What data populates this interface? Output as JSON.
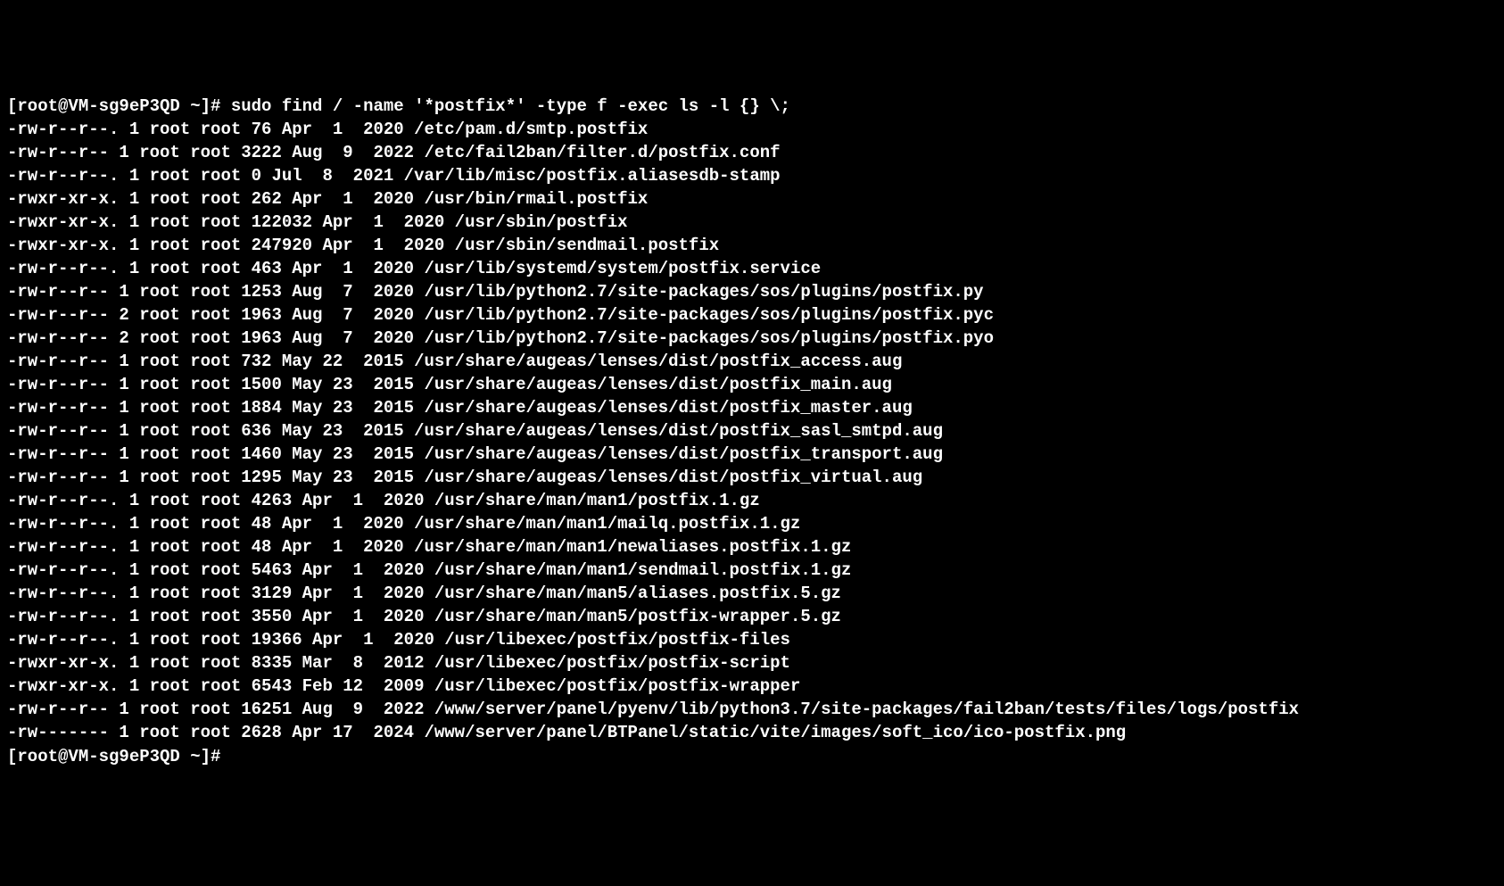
{
  "prompt1": "[root@VM-sg9eP3QD ~]# sudo find / -name '*postfix*' -type f -exec ls -l {} \\;",
  "lines": [
    "-rw-r--r--. 1 root root 76 Apr  1  2020 /etc/pam.d/smtp.postfix",
    "-rw-r--r-- 1 root root 3222 Aug  9  2022 /etc/fail2ban/filter.d/postfix.conf",
    "-rw-r--r--. 1 root root 0 Jul  8  2021 /var/lib/misc/postfix.aliasesdb-stamp",
    "-rwxr-xr-x. 1 root root 262 Apr  1  2020 /usr/bin/rmail.postfix",
    "-rwxr-xr-x. 1 root root 122032 Apr  1  2020 /usr/sbin/postfix",
    "-rwxr-xr-x. 1 root root 247920 Apr  1  2020 /usr/sbin/sendmail.postfix",
    "-rw-r--r--. 1 root root 463 Apr  1  2020 /usr/lib/systemd/system/postfix.service",
    "-rw-r--r-- 1 root root 1253 Aug  7  2020 /usr/lib/python2.7/site-packages/sos/plugins/postfix.py",
    "-rw-r--r-- 2 root root 1963 Aug  7  2020 /usr/lib/python2.7/site-packages/sos/plugins/postfix.pyc",
    "-rw-r--r-- 2 root root 1963 Aug  7  2020 /usr/lib/python2.7/site-packages/sos/plugins/postfix.pyo",
    "-rw-r--r-- 1 root root 732 May 22  2015 /usr/share/augeas/lenses/dist/postfix_access.aug",
    "-rw-r--r-- 1 root root 1500 May 23  2015 /usr/share/augeas/lenses/dist/postfix_main.aug",
    "-rw-r--r-- 1 root root 1884 May 23  2015 /usr/share/augeas/lenses/dist/postfix_master.aug",
    "-rw-r--r-- 1 root root 636 May 23  2015 /usr/share/augeas/lenses/dist/postfix_sasl_smtpd.aug",
    "-rw-r--r-- 1 root root 1460 May 23  2015 /usr/share/augeas/lenses/dist/postfix_transport.aug",
    "-rw-r--r-- 1 root root 1295 May 23  2015 /usr/share/augeas/lenses/dist/postfix_virtual.aug",
    "-rw-r--r--. 1 root root 4263 Apr  1  2020 /usr/share/man/man1/postfix.1.gz",
    "-rw-r--r--. 1 root root 48 Apr  1  2020 /usr/share/man/man1/mailq.postfix.1.gz",
    "-rw-r--r--. 1 root root 48 Apr  1  2020 /usr/share/man/man1/newaliases.postfix.1.gz",
    "-rw-r--r--. 1 root root 5463 Apr  1  2020 /usr/share/man/man1/sendmail.postfix.1.gz",
    "-rw-r--r--. 1 root root 3129 Apr  1  2020 /usr/share/man/man5/aliases.postfix.5.gz",
    "-rw-r--r--. 1 root root 3550 Apr  1  2020 /usr/share/man/man5/postfix-wrapper.5.gz",
    "-rw-r--r--. 1 root root 19366 Apr  1  2020 /usr/libexec/postfix/postfix-files",
    "-rwxr-xr-x. 1 root root 8335 Mar  8  2012 /usr/libexec/postfix/postfix-script",
    "-rwxr-xr-x. 1 root root 6543 Feb 12  2009 /usr/libexec/postfix/postfix-wrapper",
    "-rw-r--r-- 1 root root 16251 Aug  9  2022 /www/server/panel/pyenv/lib/python3.7/site-packages/fail2ban/tests/files/logs/postfix",
    "-rw------- 1 root root 2628 Apr 17  2024 /www/server/panel/BTPanel/static/vite/images/soft_ico/ico-postfix.png"
  ],
  "prompt2": "[root@VM-sg9eP3QD ~]# "
}
